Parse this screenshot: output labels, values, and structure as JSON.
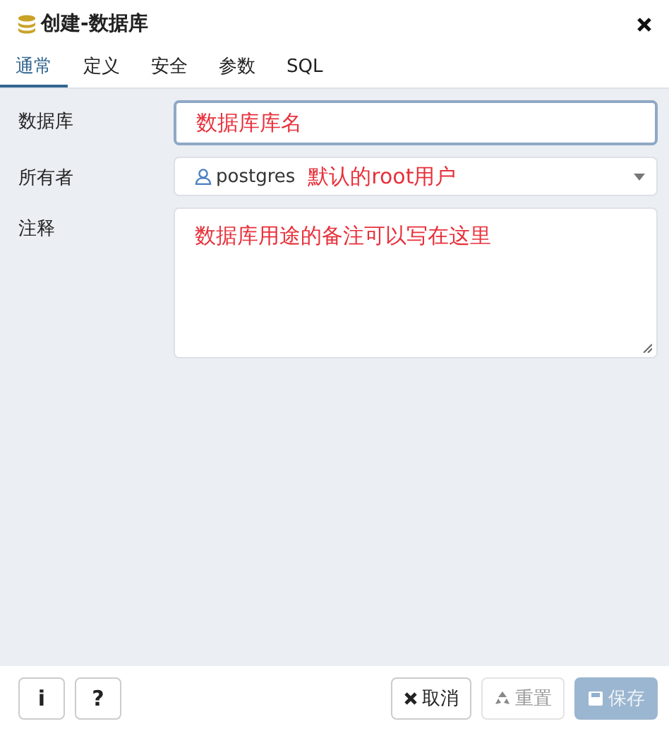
{
  "window": {
    "title": "创建-数据库"
  },
  "tabs": [
    {
      "label": "通常",
      "selected": true
    },
    {
      "label": "定义",
      "selected": false
    },
    {
      "label": "安全",
      "selected": false
    },
    {
      "label": "参数",
      "selected": false
    },
    {
      "label": "SQL",
      "selected": false
    }
  ],
  "fields": [
    {
      "kind": "input",
      "label": "数据库",
      "value": "数据库库名",
      "focused": true
    },
    {
      "kind": "select",
      "label": "所有者",
      "value": "postgres",
      "note": "默认的root用户"
    },
    {
      "kind": "textarea",
      "label": "注释",
      "value": "数据库用途的备注可以写在这里"
    }
  ],
  "footer": {
    "left_buttons": [
      {
        "label": "i"
      },
      {
        "label": "?"
      }
    ],
    "right_buttons": [
      {
        "label": "取消",
        "kind": "cancel",
        "disabled": false
      },
      {
        "label": "重置",
        "kind": "reset",
        "disabled": true
      },
      {
        "label": "保存",
        "kind": "save",
        "disabled": true
      }
    ]
  }
}
